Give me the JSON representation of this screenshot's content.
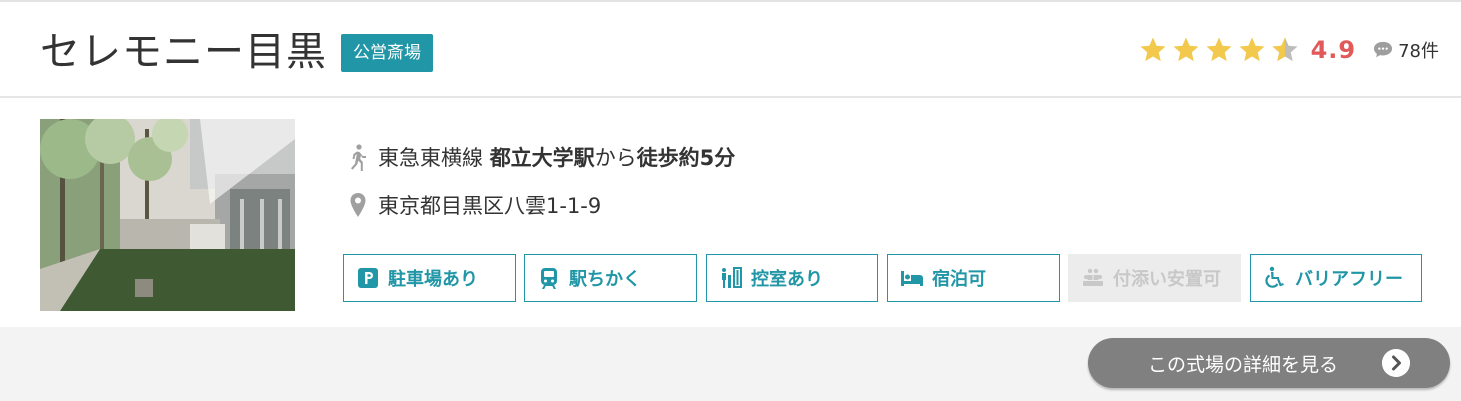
{
  "hall": {
    "name": "セレモニー目黒",
    "badge": "公営斎場"
  },
  "rating": {
    "score": "4.9",
    "stars_value": 4.5,
    "review_count": "78件",
    "star_color": "#f2c94c",
    "score_color": "#e2595a"
  },
  "access": {
    "line": "東急東横線",
    "station": "都立大学駅",
    "from": "から",
    "walk": "徒歩約5分"
  },
  "address": "東京都目黒区八雲1-1-9",
  "features": [
    {
      "label": "駐車場あり",
      "icon": "parking-icon",
      "enabled": true
    },
    {
      "label": "駅ちかく",
      "icon": "train-icon",
      "enabled": true
    },
    {
      "label": "控室あり",
      "icon": "waiting-room-icon",
      "enabled": true
    },
    {
      "label": "宿泊可",
      "icon": "bed-icon",
      "enabled": true
    },
    {
      "label": "付添い安置可",
      "icon": "people-icon",
      "enabled": false
    },
    {
      "label": "バリアフリー",
      "icon": "wheelchair-icon",
      "enabled": true
    }
  ],
  "detail_button": "この式場の詳細を見る",
  "colors": {
    "accent": "#2196a6",
    "button": "#808080"
  }
}
